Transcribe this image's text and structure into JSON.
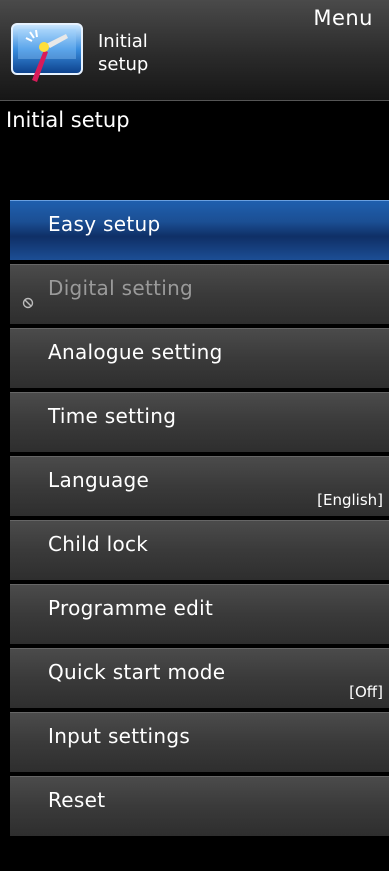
{
  "header": {
    "menu_label": "Menu",
    "icon": "setup-wrench-icon",
    "title": "Initial\nsetup"
  },
  "section_title": "Initial setup",
  "items": [
    {
      "label": "Easy setup",
      "value": "",
      "state": "selected"
    },
    {
      "label": "Digital setting",
      "value": "",
      "state": "disabled",
      "icon": "prohibited-icon"
    },
    {
      "label": "Analogue setting",
      "value": "",
      "state": "normal"
    },
    {
      "label": "Time setting",
      "value": "",
      "state": "normal"
    },
    {
      "label": "Language",
      "value": "[English]",
      "state": "normal"
    },
    {
      "label": "Child lock",
      "value": "",
      "state": "normal"
    },
    {
      "label": "Programme edit",
      "value": "",
      "state": "normal"
    },
    {
      "label": "Quick start mode",
      "value": "[Off]",
      "state": "normal"
    },
    {
      "label": "Input settings",
      "value": "",
      "state": "normal"
    },
    {
      "label": "Reset",
      "value": "",
      "state": "normal"
    }
  ],
  "colors": {
    "selected_top": "#1f5fae",
    "selected_bottom": "#0f2f66",
    "item_bg": "#3a3a3a",
    "disabled_text": "#9a9a9a"
  }
}
